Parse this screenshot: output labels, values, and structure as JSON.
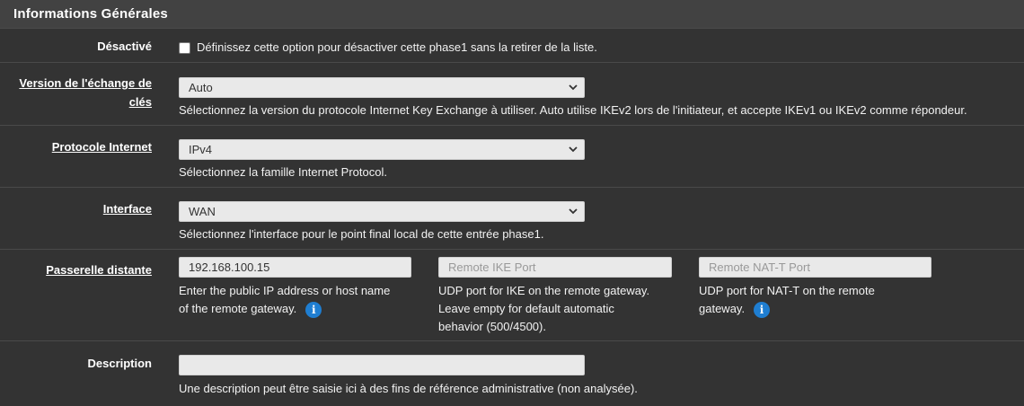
{
  "section": {
    "title": "Informations Générales"
  },
  "disabled": {
    "label": "Désactivé",
    "checkbox_text": "Définissez cette option pour désactiver cette phase1 sans la retirer de la liste."
  },
  "ike_version": {
    "label_line1": "Version de l'échange de",
    "label_line2": "clés",
    "value": "Auto",
    "help": "Sélectionnez la version du protocole Internet Key Exchange à utiliser. Auto utilise IKEv2 lors de l'initiateur, et accepte IKEv1 ou IKEv2 comme répondeur."
  },
  "protocol": {
    "label": "Protocole Internet",
    "value": "IPv4",
    "help": "Sélectionnez la famille Internet Protocol."
  },
  "interface": {
    "label": "Interface",
    "value": "WAN",
    "help": "Sélectionnez l'interface pour le point final local de cette entrée phase1."
  },
  "remote_gateway": {
    "label": "Passerelle distante",
    "address_value": "192.168.100.15",
    "address_help_line1": "Enter the public IP address or host name",
    "address_help_line2": "of the remote gateway.",
    "ike_port_placeholder": "Remote IKE Port",
    "ike_port_help_line1": "UDP port for IKE on the remote gateway.",
    "ike_port_help_line2": "Leave empty for default automatic",
    "ike_port_help_line3": "behavior (500/4500).",
    "natt_port_placeholder": "Remote NAT-T Port",
    "natt_port_help_line1": "UDP port for NAT-T on the remote",
    "natt_port_help_line2": "gateway."
  },
  "description": {
    "label": "Description",
    "value": "",
    "help": "Une description peut être saisie ici à des fins de référence administrative (non analysée)."
  },
  "icons": {
    "info": "info-icon",
    "chevron": "chevron-updown-icon"
  },
  "colors": {
    "background": "#333333",
    "heading": "#424242",
    "info": "#1f7ed1"
  }
}
